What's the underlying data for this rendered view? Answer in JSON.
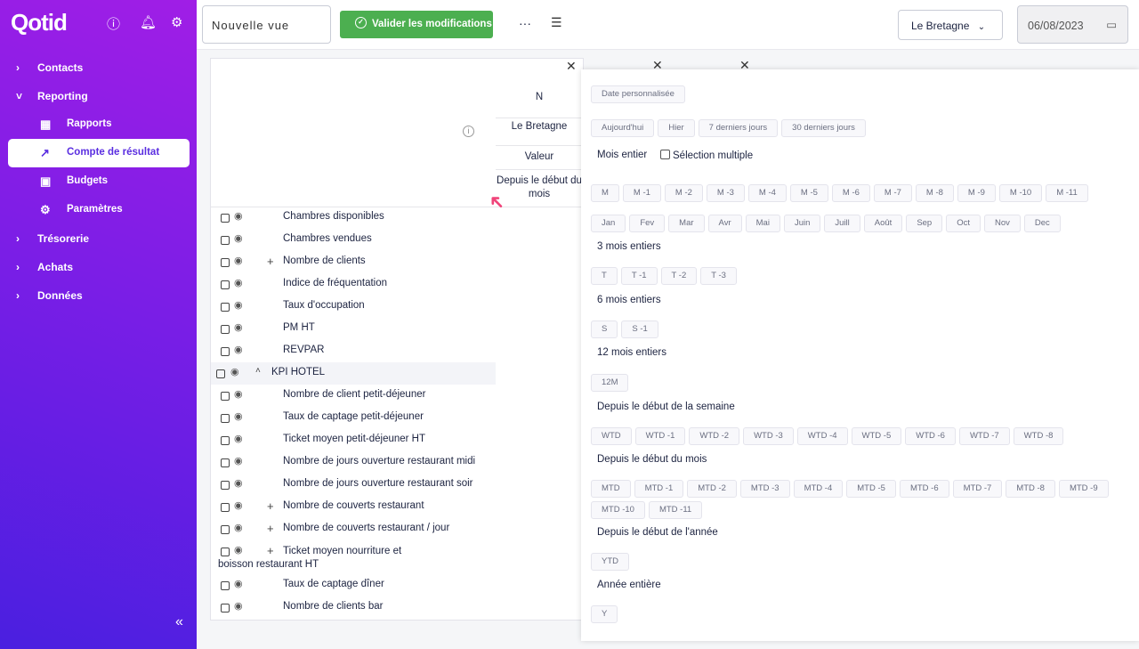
{
  "sidebar": {
    "logo": "Qotid",
    "items": [
      {
        "label": "Contacts"
      },
      {
        "label": "Reporting"
      },
      {
        "label": "Trésorerie"
      },
      {
        "label": "Achats"
      },
      {
        "label": "Données"
      }
    ],
    "sub": [
      {
        "label": "Rapports"
      },
      {
        "label": "Compte de résultat"
      },
      {
        "label": "Budgets"
      },
      {
        "label": "Paramètres"
      }
    ]
  },
  "toolbar": {
    "view_name": "Nouvelle vue",
    "validate": "Valider les modifications",
    "hotel": "Le Bretagne",
    "date": "06/08/2023"
  },
  "table": {
    "headers": [
      "N",
      "Le Bretagne",
      "Valeur",
      "Depuis le début du mois"
    ],
    "rows": [
      {
        "label": "Chambres disponibles",
        "plus": false
      },
      {
        "label": "Chambres vendues",
        "plus": false
      },
      {
        "label": "Nombre de clients",
        "plus": true
      },
      {
        "label": "Indice de fréquentation",
        "plus": false
      },
      {
        "label": "Taux d'occupation",
        "plus": false
      },
      {
        "label": "PM HT",
        "plus": false
      },
      {
        "label": "REVPAR",
        "plus": false
      },
      {
        "label": "KPI HOTEL",
        "group": true
      },
      {
        "label": "Nombre de client petit-déjeuner",
        "plus": false
      },
      {
        "label": "Taux de captage petit-déjeuner",
        "plus": false
      },
      {
        "label": "Ticket moyen petit-déjeuner HT",
        "plus": false
      },
      {
        "label": "Nombre de jours ouverture restaurant midi",
        "plus": false
      },
      {
        "label": "Nombre de jours ouverture restaurant soir",
        "plus": false
      },
      {
        "label": "Nombre de couverts restaurant",
        "plus": true
      },
      {
        "label": "Nombre de couverts restaurant / jour",
        "plus": true
      },
      {
        "label": "Ticket moyen nourriture et boisson restaurant HT",
        "plus": true
      },
      {
        "label": "Taux de captage dîner",
        "plus": false
      },
      {
        "label": "Nombre de clients bar",
        "plus": false
      }
    ]
  },
  "panel": {
    "custom": [
      "Date personnalisée"
    ],
    "quick": [
      "Aujourd'hui",
      "Hier",
      "7 derniers jours",
      "30 derniers jours"
    ],
    "mois_entier": "Mois entier",
    "multi": "Sélection multiple",
    "m": [
      "M",
      "M -1",
      "M -2",
      "M -3",
      "M -4",
      "M -5",
      "M -6",
      "M -7",
      "M -8",
      "M -9",
      "M -10",
      "M -11"
    ],
    "months": [
      "Jan",
      "Fev",
      "Mar",
      "Avr",
      "Mai",
      "Juin",
      "Juill",
      "Août",
      "Sep",
      "Oct",
      "Nov",
      "Dec"
    ],
    "sections": [
      {
        "title": "3 mois entiers",
        "chips": [
          "T",
          "T -1",
          "T -2",
          "T -3"
        ]
      },
      {
        "title": "6 mois entiers",
        "chips": [
          "S",
          "S -1"
        ]
      },
      {
        "title": "12 mois entiers",
        "chips": [
          "12M"
        ]
      },
      {
        "title": "Depuis le début de la semaine",
        "chips": [
          "WTD",
          "WTD -1",
          "WTD -2",
          "WTD -3",
          "WTD -4",
          "WTD -5",
          "WTD -6",
          "WTD -7",
          "WTD -8"
        ]
      },
      {
        "title": "Depuis le début du mois",
        "chips": [
          "MTD",
          "MTD -1",
          "MTD -2",
          "MTD -3",
          "MTD -4",
          "MTD -5",
          "MTD -6",
          "MTD -7",
          "MTD -8",
          "MTD -9",
          "MTD -10",
          "MTD -11"
        ]
      },
      {
        "title": "Depuis le début de l'année",
        "chips": [
          "YTD"
        ]
      },
      {
        "title": "Année entière",
        "chips": [
          "Y"
        ]
      }
    ]
  }
}
